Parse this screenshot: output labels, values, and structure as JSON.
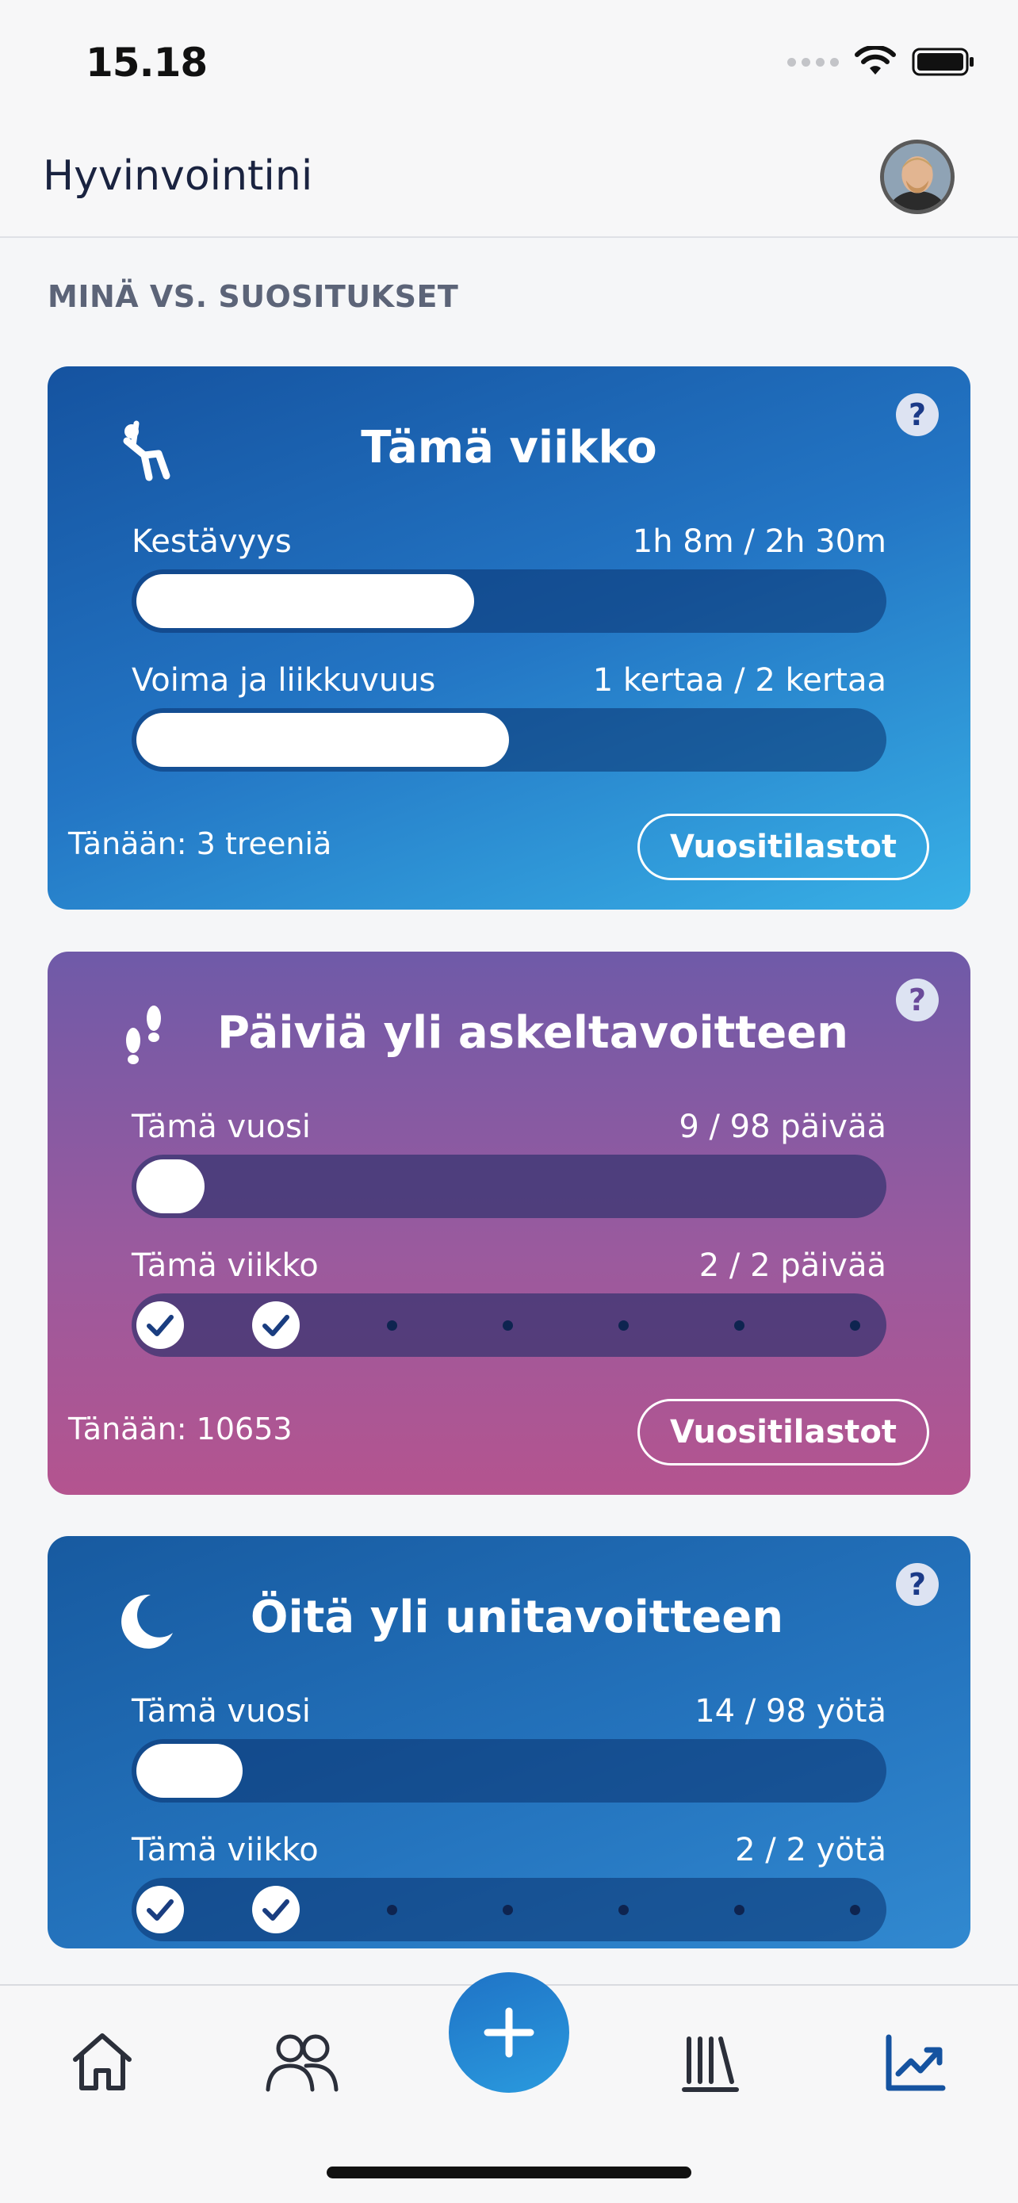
{
  "status_bar": {
    "time": "15.18"
  },
  "header": {
    "title": "Hyvinvointini"
  },
  "section_label": "MINÄ VS. SUOSITUKSET",
  "cards": [
    {
      "icon": "exercise-figure-icon",
      "title": "Tämä viikko",
      "help": "?",
      "rows": [
        {
          "label": "Kestävyys",
          "value": "1h 8m / 2h 30m",
          "progress": 0.453
        },
        {
          "label": "Voima ja liikkuvuus",
          "value": "1 kertaa / 2 kertaa",
          "progress": 0.5
        }
      ],
      "footer_text": "Tänään: 3 treeniä",
      "button_label": "Vuositilastot"
    },
    {
      "icon": "footsteps-icon",
      "title": "Päiviä yli askeltavoitteen",
      "help": "?",
      "rows": [
        {
          "label": "Tämä vuosi",
          "value": "9 / 98 päivää",
          "progress": 0.092
        },
        {
          "label": "Tämä viikko",
          "value": "2 / 2 päivää",
          "days": [
            true,
            true,
            false,
            false,
            false,
            false,
            false
          ]
        }
      ],
      "footer_text": "Tänään: 10653",
      "button_label": "Vuositilastot"
    },
    {
      "icon": "moon-icon",
      "title": "Öitä yli unitavoitteen",
      "help": "?",
      "rows": [
        {
          "label": "Tämä vuosi",
          "value": "14 / 98 yötä",
          "progress": 0.143
        },
        {
          "label": "Tämä viikko",
          "value": "2 / 2 yötä",
          "days": [
            true,
            true,
            false,
            false,
            false,
            false,
            false
          ]
        }
      ]
    }
  ],
  "nav": [
    "home-icon",
    "people-icon",
    "add-icon",
    "library-icon",
    "stats-icon"
  ],
  "colors": {
    "accent": "#1f73c6",
    "nav_active": "#1553a0",
    "nav_icon": "#2b2f3a"
  }
}
